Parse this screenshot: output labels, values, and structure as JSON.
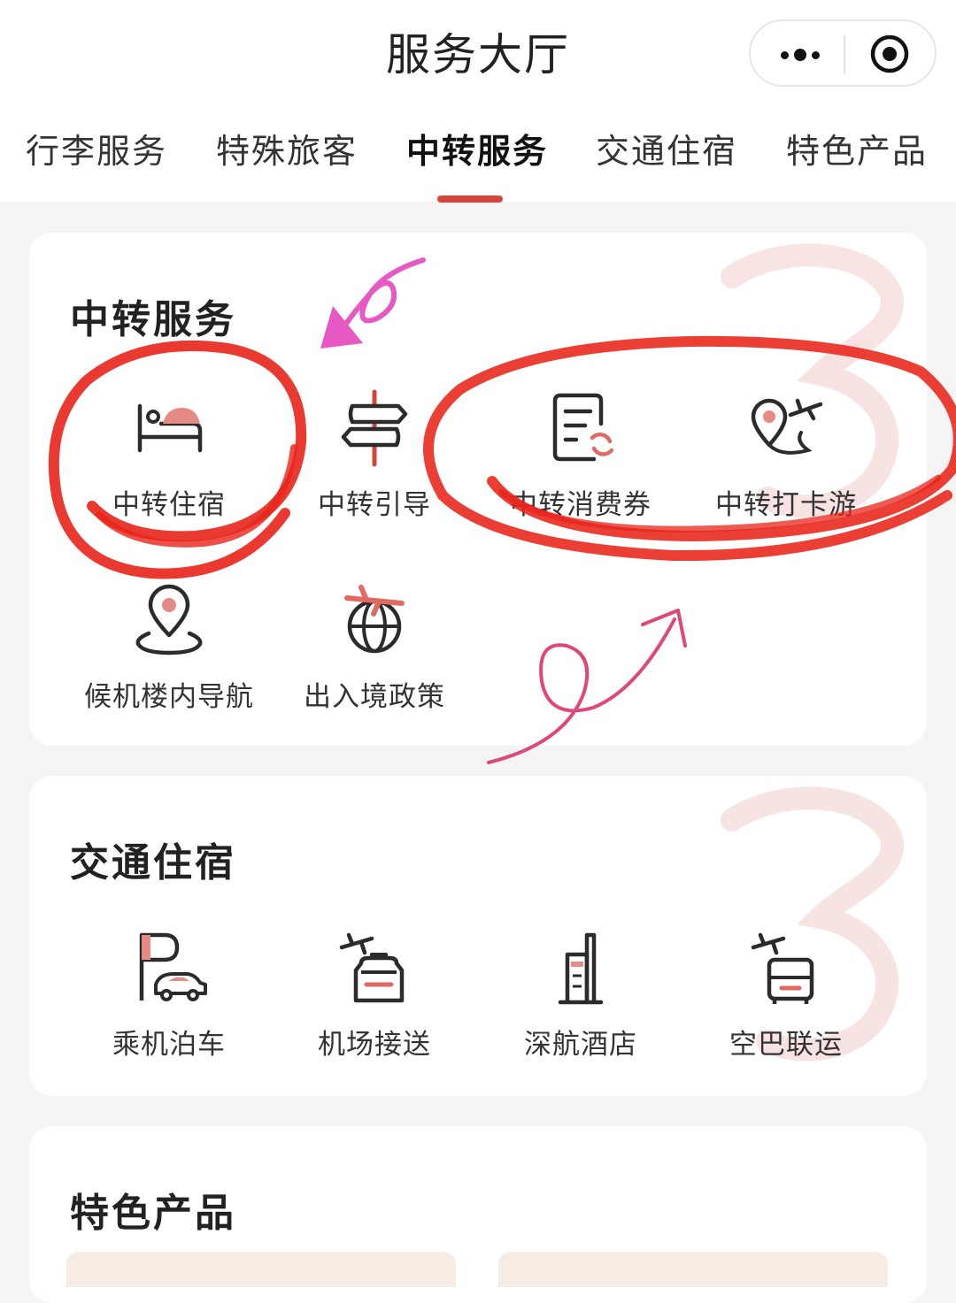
{
  "header": {
    "title": "服务大厅",
    "more_icon": "more-dots-icon",
    "close_icon": "target-close-icon"
  },
  "tabs": [
    {
      "label": "行李服务",
      "active": false
    },
    {
      "label": "特殊旅客",
      "active": false
    },
    {
      "label": "中转服务",
      "active": true
    },
    {
      "label": "交通住宿",
      "active": false
    },
    {
      "label": "特色产品",
      "active": false
    }
  ],
  "sections": {
    "transfer": {
      "title": "中转服务",
      "items": [
        {
          "label": "中转住宿",
          "icon": "bed-icon"
        },
        {
          "label": "中转引导",
          "icon": "signpost-icon"
        },
        {
          "label": "中转消费券",
          "icon": "voucher-icon"
        },
        {
          "label": "中转打卡游",
          "icon": "location-plane-icon"
        },
        {
          "label": "候机楼内导航",
          "icon": "map-pin-icon"
        },
        {
          "label": "出入境政策",
          "icon": "globe-plane-icon"
        }
      ]
    },
    "transport": {
      "title": "交通住宿",
      "items": [
        {
          "label": "乘机泊车",
          "icon": "parking-car-icon"
        },
        {
          "label": "机场接送",
          "icon": "airport-taxi-icon"
        },
        {
          "label": "深航酒店",
          "icon": "hotel-building-icon"
        },
        {
          "label": "空巴联运",
          "icon": "plane-bus-icon"
        }
      ]
    },
    "products": {
      "title": "特色产品"
    }
  },
  "colors": {
    "accent": "#d7443a",
    "icon_stroke": "#2b2b2b",
    "annotation_red": "#e8241a",
    "annotation_pink": "#e0457b",
    "annotation_magenta": "#e659c4"
  }
}
